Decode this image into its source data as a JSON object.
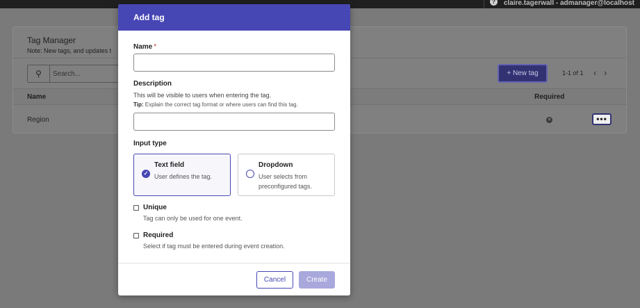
{
  "topbar": {
    "user_text": "claire.tagerwall - admanager@localhost",
    "help_icon": "question-circle-icon"
  },
  "tag_manager": {
    "title": "Tag Manager",
    "note": "Note: New tags, and updates t",
    "search": {
      "placeholder": "Search...",
      "icon": "search-icon"
    },
    "new_tag_button": "+ New tag",
    "pagination": "1-1 of 1",
    "prev_icon": "‹",
    "next_icon": "›",
    "columns": {
      "name": "Name",
      "required": "Required"
    },
    "rows": [
      {
        "name": "Region",
        "more_label": "•••"
      }
    ]
  },
  "modal": {
    "title": "Add tag",
    "name_label": "Name",
    "required_marker": "*",
    "name_value": "",
    "description_label": "Description",
    "description_help": "This will be visible to users when entering the tag.",
    "tip_prefix": "Tip:",
    "tip_text": "Explain the correct tag format or where users can find this tag.",
    "description_value": "",
    "input_type_label": "Input type",
    "options": [
      {
        "title": "Text field",
        "desc": "User defines the tag.",
        "selected": true
      },
      {
        "title": "Dropdown",
        "desc": "User selects from preconfigured tags.",
        "selected": false
      }
    ],
    "unique": {
      "label": "Unique",
      "desc": "Tag can only be used for one event.",
      "checked": false
    },
    "required": {
      "label": "Required",
      "desc": "Select if tag must be entered during event creation.",
      "checked": false
    },
    "cancel_button": "Cancel",
    "create_button": "Create"
  },
  "colors": {
    "accent": "#4646b5",
    "accent_disabled": "#a8a8dc",
    "overlay": "#7a7a7a"
  }
}
